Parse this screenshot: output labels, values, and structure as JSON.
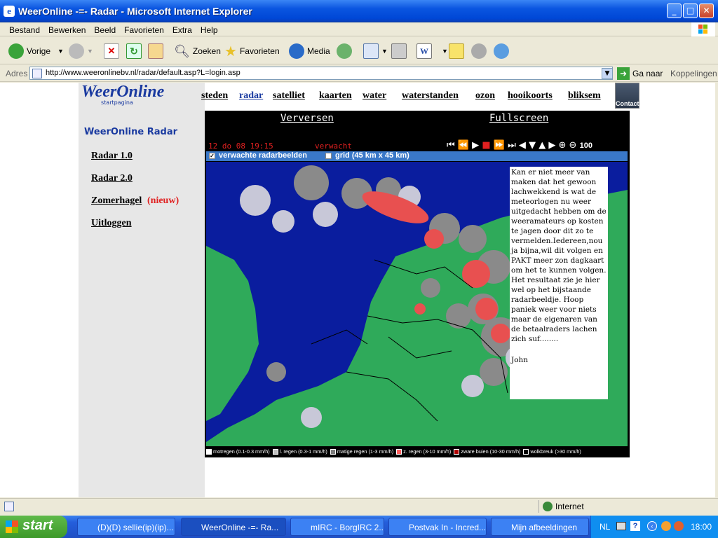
{
  "window": {
    "title": "WeerOnline -=- Radar - Microsoft Internet Explorer"
  },
  "menu": [
    "Bestand",
    "Bewerken",
    "Beeld",
    "Favorieten",
    "Extra",
    "Help"
  ],
  "toolbar": {
    "back": "Vorige",
    "search": "Zoeken",
    "favorites": "Favorieten",
    "media": "Media"
  },
  "address": {
    "label": "Adres",
    "url": "http://www.weeronlinebv.nl/radar/default.asp?L=login.asp",
    "go": "Ga naar",
    "links": "Koppelingen"
  },
  "site": {
    "logo": "WeerOnline",
    "logo_sub": "startpagina",
    "nav": [
      "steden",
      "radar",
      "satelliet",
      "kaarten",
      "water",
      "waterstanden",
      "ozon",
      "hooikoorts",
      "bliksem"
    ],
    "contact": "Contact"
  },
  "sidebar": {
    "heading": "WeerOnline Radar",
    "items": [
      "Radar 1.0",
      "Radar 2.0",
      "Zomerhagel",
      "Uitloggen"
    ],
    "new_tag": "(nieuw)"
  },
  "radar": {
    "refresh": "Verversen",
    "fullscreen": "Fullscreen",
    "timestamp": "12 do 08 19:15",
    "mode": "verwacht",
    "zoom": "100",
    "opt_forecast": "verwachte radarbeelden",
    "opt_grid": "grid (45 km x 45 km)",
    "note": "Kan er niet meer van maken dat het gewoon lachwekkend is wat de meteorlogen nu weer uitgedacht hebben om de weeramateurs op kosten te jagen door dit zo te vermelden.Iedereen,nou ja bijna,wil dit volgen en PAKT meer zon dagkaart om het te kunnen volgen. Het resultaat zie je hier wel op het bijstaande radarbeeldje. Hoop paniek weer voor niets maar de eigenaren van de betaalraders lachen zich suf........",
    "signature": "John",
    "legend": [
      {
        "label": "motregen (0.1-0.3 mm/h)",
        "color": "#ffffff"
      },
      {
        "label": "l. regen (0.3-1 mm/h)",
        "color": "#bfbfbf"
      },
      {
        "label": "matige regen (1-3 mm/h)",
        "color": "#808080"
      },
      {
        "label": "z. regen (3-10 mm/h)",
        "color": "#ff6060"
      },
      {
        "label": "zware buien (10-30 mm/h)",
        "color": "#b00000"
      },
      {
        "label": "wolkbreuk (>30 mm/h)",
        "color": "#000000"
      }
    ]
  },
  "status": {
    "zone": "Internet"
  },
  "taskbar": {
    "start": "start",
    "tasks": [
      "(D)(D) sellie(ip)(ip)...",
      "WeerOnline -=- Ra...",
      "mIRC - BorgIRC 2....",
      "Postvak In - Incred...",
      "Mijn afbeeldingen"
    ],
    "lang": "NL",
    "clock": "18:00"
  },
  "colors": {
    "xp_blue": "#0047d6",
    "land": "#2faa5a",
    "sea": "#0a1d9e",
    "rain_red": "#e85050"
  }
}
